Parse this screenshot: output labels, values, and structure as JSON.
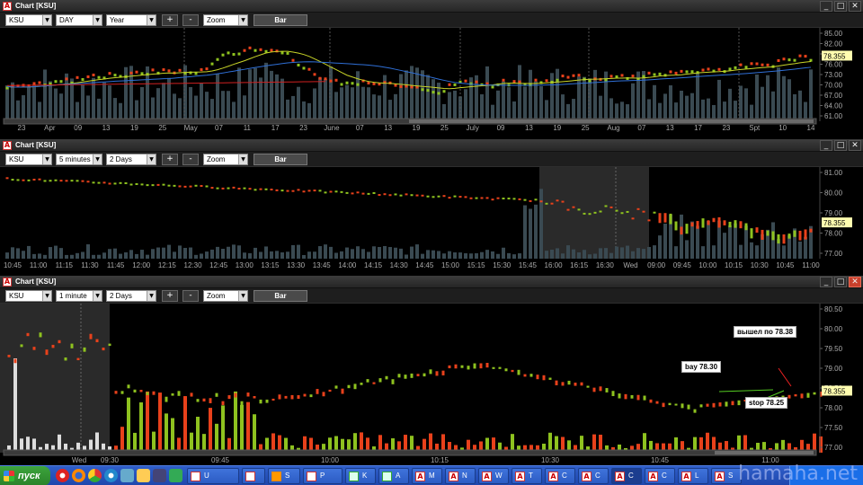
{
  "panels": [
    {
      "title": "Chart [KSU]",
      "symbol": "KSU",
      "interval": "DAY",
      "range": "Year",
      "zoom": "Zoom",
      "bar_label": "Bar",
      "plus": "+",
      "minus": "-",
      "y_ticks": [
        "85.00",
        "82.00",
        "79.00",
        "76.00",
        "73.00",
        "70.00",
        "67.00",
        "64.00",
        "61.00"
      ],
      "price_tag": "78.355",
      "x_ticks": [
        "23",
        "Apr",
        "09",
        "13",
        "19",
        "25",
        "May",
        "07",
        "11",
        "17",
        "23",
        "June",
        "07",
        "13",
        "19",
        "25",
        "July",
        "09",
        "13",
        "19",
        "25",
        "Aug",
        "07",
        "13",
        "17",
        "23",
        "Spt",
        "10",
        "14"
      ]
    },
    {
      "title": "Chart [KSU]",
      "symbol": "KSU",
      "interval": "5 minutes",
      "range": "2 Days",
      "zoom": "Zoom",
      "bar_label": "Bar",
      "plus": "+",
      "minus": "-",
      "y_ticks": [
        "81.00",
        "80.00",
        "79.00",
        "78.00",
        "77.00"
      ],
      "price_tag": "78.355",
      "x_ticks": [
        "10:45",
        "11:00",
        "11:15",
        "11:30",
        "11:45",
        "12:00",
        "12:15",
        "12:30",
        "12:45",
        "13:00",
        "13:15",
        "13:30",
        "13:45",
        "14:00",
        "14:15",
        "14:30",
        "14:45",
        "15:00",
        "15:15",
        "15:30",
        "15:45",
        "16:00",
        "16:15",
        "16:30",
        "Wed",
        "09:00",
        "09:45",
        "10:00",
        "10:15",
        "10:30",
        "10:45",
        "11:00"
      ]
    },
    {
      "title": "Chart [KSU]",
      "symbol": "KSU",
      "interval": "1 minute",
      "range": "2 Days",
      "zoom": "Zoom",
      "bar_label": "Bar",
      "plus": "+",
      "minus": "-",
      "y_ticks": [
        "80.50",
        "80.00",
        "79.50",
        "79.00",
        "78.50",
        "78.00",
        "77.50",
        "77.00"
      ],
      "price_tag": "78.355",
      "x_ticks": [
        "Wed",
        "09:30",
        "09:45",
        "10:00",
        "10:15",
        "10:30",
        "10:45",
        "11:00"
      ],
      "annotations": {
        "exit": "вышел по 78.38",
        "buy": "bay 78.30",
        "stop": "stop 78.25"
      }
    }
  ],
  "colors": {
    "up": "#8ec21f",
    "down": "#e8411b",
    "volume": "#3a4a52",
    "ma_yellow": "#c8d428",
    "ma_blue": "#2f6fd6",
    "ma_red": "#d02020",
    "price_tag_bg": "#fffdb0"
  },
  "taskbar": {
    "start_label": "пуск",
    "items": [
      {
        "label": "U",
        "icon": "file-icon"
      },
      {
        "label": "",
        "icon": "firefox-icon"
      },
      {
        "label": "S",
        "icon": "skype-icon"
      },
      {
        "label": "P",
        "icon": "app-icon"
      },
      {
        "label": "K",
        "icon": "k-icon"
      },
      {
        "label": "A",
        "icon": "k-icon"
      },
      {
        "label": "M",
        "icon": "chart-icon"
      },
      {
        "label": "N",
        "icon": "chart-icon"
      },
      {
        "label": "W",
        "icon": "chart-icon"
      },
      {
        "label": "T",
        "icon": "chart-icon"
      },
      {
        "label": "C",
        "icon": "chart-icon"
      },
      {
        "label": "C",
        "icon": "chart-icon"
      },
      {
        "label": "C",
        "icon": "chart-icon"
      },
      {
        "label": "C",
        "icon": "chart-icon"
      },
      {
        "label": "L",
        "icon": "chart-icon"
      },
      {
        "label": "S",
        "icon": "chart-icon"
      }
    ],
    "watermark": "hamaha.net"
  }
}
